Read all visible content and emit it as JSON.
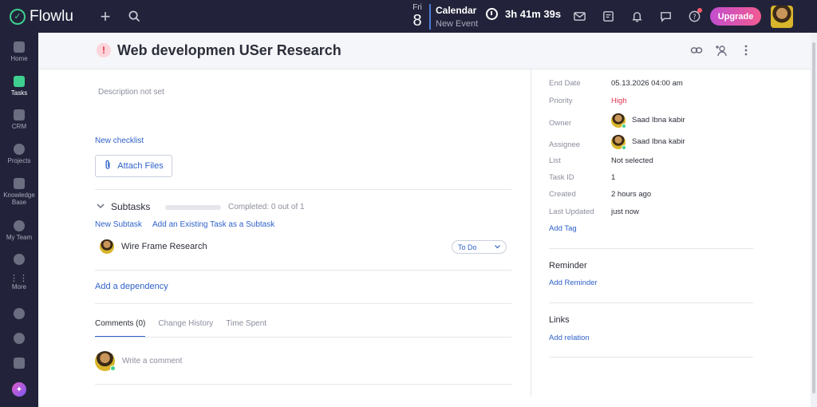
{
  "app": {
    "name": "Flowlu"
  },
  "topbar": {
    "calendar_day": "Fri",
    "calendar_date": "8",
    "calendar_title": "Calendar",
    "calendar_sub": "New Event",
    "timer": "3h 41m 39s",
    "upgrade_label": "Upgrade",
    "icons": [
      "add-icon",
      "search-icon",
      "clock-icon",
      "mail-icon",
      "notes-icon",
      "bell-icon",
      "chat-icon",
      "help-icon"
    ]
  },
  "sidebar": {
    "items": [
      {
        "label": "Home"
      },
      {
        "label": "Tasks"
      },
      {
        "label": "CRM"
      },
      {
        "label": "Projects"
      },
      {
        "label": "Knowledge Base"
      },
      {
        "label": "My Team"
      },
      {
        "label": "More"
      }
    ]
  },
  "task": {
    "title": "Web developmen USer Research",
    "description": "Description not set",
    "new_checklist": "New checklist",
    "attach_files": "Attach Files",
    "subtasks_title": "Subtasks",
    "completed": "Completed: 0 out of 1",
    "progress": 0,
    "new_subtask": "New Subtask",
    "add_existing": "Add an Existing Task as a Subtask",
    "subtask": {
      "name": "Wire Frame Research",
      "status": "To Do"
    },
    "add_dependency": "Add a dependency",
    "tabs": [
      "Comments (0)",
      "Change History",
      "Time Spent"
    ],
    "comment_placeholder": "Write a comment"
  },
  "properties": {
    "end_date": {
      "label": "End Date",
      "value": "05.13.2026  04:00 am"
    },
    "priority": {
      "label": "Priority",
      "value": "High"
    },
    "owner": {
      "label": "Owner",
      "value": "Saad Ibna kabir"
    },
    "assignee": {
      "label": "Assignee",
      "value": "Saad Ibna kabir"
    },
    "list": {
      "label": "List",
      "value": "Not selected"
    },
    "task_id": {
      "label": "Task ID",
      "value": "1"
    },
    "created": {
      "label": "Created",
      "value": "2 hours ago"
    },
    "last_updated": {
      "label": "Last Updated",
      "value": "just now"
    },
    "add_tag": "Add Tag"
  },
  "reminder": {
    "title": "Reminder",
    "add": "Add Reminder"
  },
  "links": {
    "title": "Links",
    "add": "Add relation"
  },
  "colors": {
    "accent": "#2f62c9",
    "sidebar": "#22233a",
    "priority_high": "#e2334f",
    "online": "#3ecf8e"
  }
}
